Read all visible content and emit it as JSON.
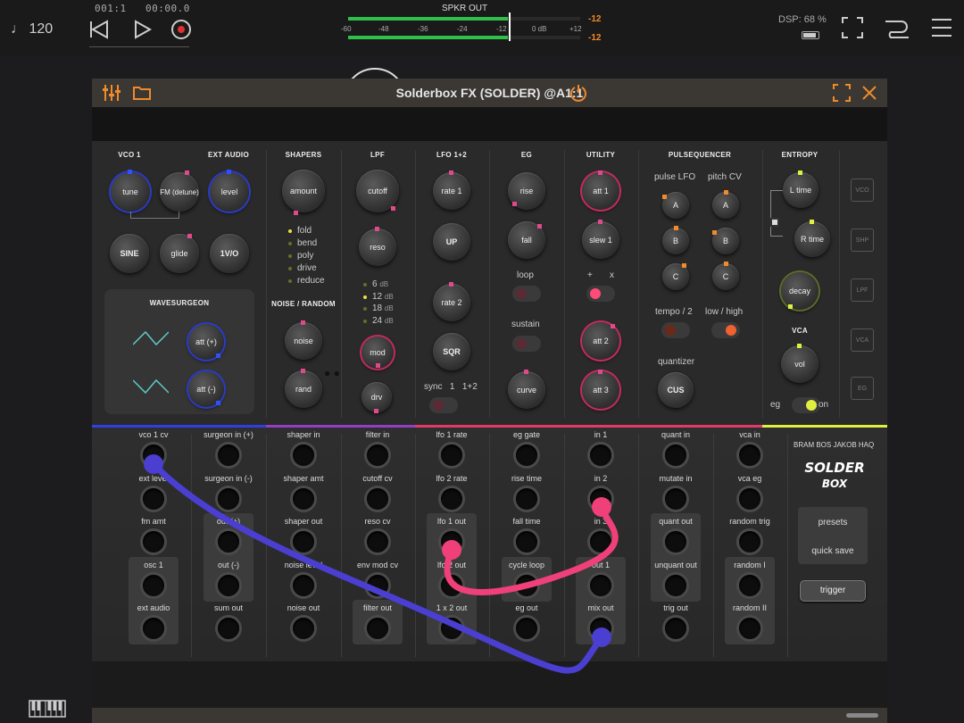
{
  "host": {
    "tempo": "♩ 120",
    "position": "001:1",
    "time": "00:00.0",
    "meter_title": "SPKR OUT",
    "meter_ticks": [
      "-60",
      "-48",
      "-36",
      "-24",
      "-12",
      "0 dB",
      "+12"
    ],
    "peak_left": "-12",
    "peak_right": "-12",
    "dsp": "DSP: 68 %"
  },
  "plugin": {
    "title": "Solderbox FX (SOLDER) @A1:1",
    "sections": {
      "vco1": "VCO 1",
      "ext_audio": "EXT AUDIO",
      "shapers": "SHAPERS",
      "lpf": "LPF",
      "lfo": "LFO 1+2",
      "eg": "EG",
      "utility": "UTILITY",
      "pulsequencer": "PULSEQUENCER",
      "entropy": "ENTROPY",
      "wavesurgeon": "WAVESURGEON",
      "noise_random": "NOISE / RANDOM",
      "vca": "VCA"
    },
    "knobs": {
      "tune": "tune",
      "fm": "FM (detune)",
      "level": "level",
      "sine": "SINE",
      "glide": "glide",
      "v_oct": "1V/O",
      "amount": "amount",
      "cutoff": "cutoff",
      "reso": "reso",
      "mod": "mod",
      "drv": "drv",
      "rate1": "rate 1",
      "up": "UP",
      "rate2": "rate 2",
      "sqr": "SQR",
      "rise": "rise",
      "fall": "fall",
      "curve": "curve",
      "att1": "att 1",
      "slew1": "slew 1",
      "att2": "att 2",
      "att3": "att 3",
      "a1": "A",
      "b1": "B",
      "c1": "C",
      "a2": "A",
      "b2": "B",
      "c2": "C",
      "cus": "CUS",
      "l_time": "L time",
      "r_time": "R time",
      "decay": "decay",
      "vol": "vol",
      "att_plus": "att (+)",
      "att_minus": "att (-)",
      "noise": "noise",
      "rand": "rand"
    },
    "shaper_modes": [
      {
        "label": "fold",
        "on": true
      },
      {
        "label": "bend",
        "on": false
      },
      {
        "label": "poly",
        "on": false
      },
      {
        "label": "drive",
        "on": false
      },
      {
        "label": "reduce",
        "on": false
      }
    ],
    "slopes": [
      {
        "label": "6",
        "unit": "dB",
        "on": false
      },
      {
        "label": "12",
        "unit": "dB",
        "on": true
      },
      {
        "label": "18",
        "unit": "dB",
        "on": false
      },
      {
        "label": "24",
        "unit": "dB",
        "on": false
      }
    ],
    "labels": {
      "pulse_lfo": "pulse LFO",
      "pitch_cv": "pitch CV",
      "loop": "loop",
      "sustain": "sustain",
      "plus": "+",
      "times": "x",
      "sync": "sync",
      "sync_1": "1",
      "sync_12": "1+2",
      "tempo2": "tempo / 2",
      "lowhigh": "low / high",
      "quantizer": "quantizer",
      "eg": "eg",
      "on": "on"
    },
    "sidebar_nodes": [
      "VCO",
      "SHP",
      "LPF",
      "VCA",
      "EG"
    ],
    "patch_columns": [
      [
        "vco 1 cv",
        "ext level",
        "fm amt",
        "osc 1",
        "ext audio"
      ],
      [
        "surgeon in (+)",
        "surgeon in (-)",
        "out (+)",
        "out (-)",
        "sum out"
      ],
      [
        "shaper in",
        "shaper amt",
        "shaper out",
        "noise level",
        "noise out"
      ],
      [
        "filter in",
        "cutoff cv",
        "reso cv",
        "env mod cv",
        "filter out"
      ],
      [
        "lfo 1 rate",
        "lfo 2 rate",
        "lfo 1 out",
        "lfo 2 out",
        "1 x 2 out"
      ],
      [
        "eg gate",
        "rise time",
        "fall time",
        "cycle loop",
        "eg out"
      ],
      [
        "in 1",
        "in 2",
        "in 3",
        "out 1",
        "mix out"
      ],
      [
        "quant in",
        "mutate in",
        "quant out",
        "unquant out",
        "trig out"
      ],
      [
        "vca in",
        "vca eg",
        "random trig",
        "random I",
        "random II"
      ]
    ],
    "credit": "BRAM BOS  JAKOB HAQ",
    "logo_text": "SOLDER BOX",
    "presets": "presets",
    "quick_save": "quick save",
    "trigger": "trigger"
  },
  "colors": {
    "accent_orange": "#f08a2a",
    "cable_blue": "#4a3fd0",
    "cable_pink": "#f0407a",
    "meter_green": "#2fbf4a"
  }
}
